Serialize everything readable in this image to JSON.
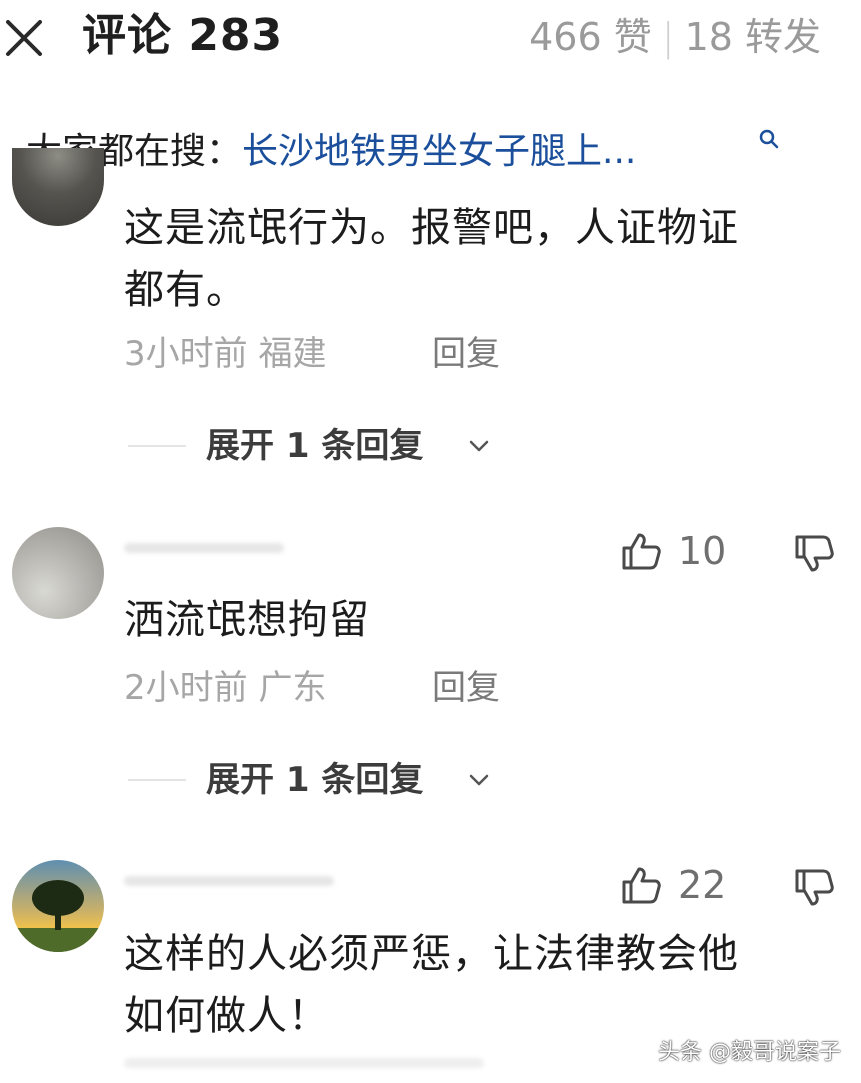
{
  "header": {
    "title": "评论 283",
    "likes": "466 赞",
    "separator": "|",
    "shares": "18 转发"
  },
  "hot_search": {
    "label": "大家都在搜：",
    "term": "长沙地铁男坐女子腿上..."
  },
  "comments": [
    {
      "text_line1": "这是流氓行为。报警吧，人证物证",
      "text_line2": "都有。",
      "time": "3小时前",
      "location": "福建",
      "reply_label": "回复",
      "expand_label": "展开 1 条回复"
    },
    {
      "likes": "10",
      "text_line1": "洒流氓想拘留",
      "time": "2小时前",
      "location": "广东",
      "reply_label": "回复",
      "expand_label": "展开 1 条回复"
    },
    {
      "likes": "22",
      "text_line1": "这样的人必须严惩，让法律教会他",
      "text_line2": "如何做人！"
    }
  ],
  "watermark": "头条 @毅哥说案子",
  "icons": {
    "close": "close-icon",
    "search": "search-icon",
    "like": "thumbs-up-icon",
    "dislike": "thumbs-down-icon",
    "expand": "chevron-down-icon"
  },
  "colors": {
    "link_blue": "#1b4f9c",
    "muted_gray": "#a6a6a6"
  }
}
